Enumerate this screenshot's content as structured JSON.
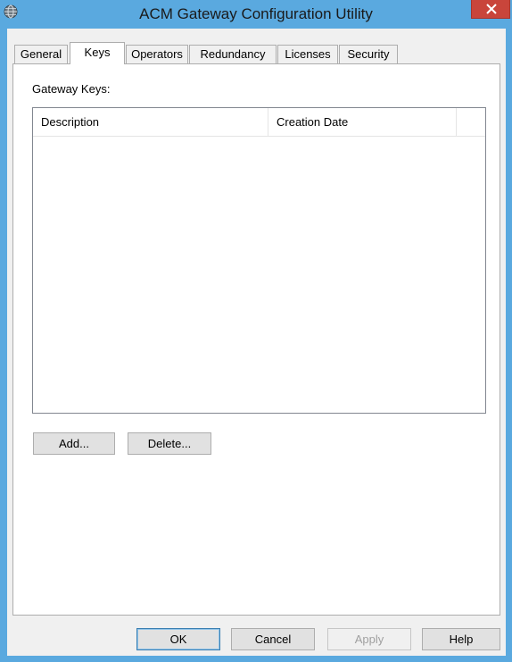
{
  "window": {
    "title": "ACM Gateway Configuration Utility"
  },
  "tabs": [
    {
      "label": "General",
      "active": false
    },
    {
      "label": "Keys",
      "active": true
    },
    {
      "label": "Operators",
      "active": false
    },
    {
      "label": "Redundancy",
      "active": false
    },
    {
      "label": "Licenses",
      "active": false
    },
    {
      "label": "Security",
      "active": false
    }
  ],
  "keys_panel": {
    "group_label": "Gateway Keys:",
    "columns": [
      "Description",
      "Creation Date"
    ],
    "rows": [],
    "add_label": "Add...",
    "delete_label": "Delete..."
  },
  "footer": {
    "ok_label": "OK",
    "cancel_label": "Cancel",
    "apply_label": "Apply",
    "apply_enabled": false,
    "help_label": "Help"
  },
  "icons": {
    "app": "globe-icon",
    "close": "close-icon"
  },
  "colors": {
    "titlebar": "#5aa9df",
    "close_button": "#c9453b",
    "dialog_background": "#f0f0f0"
  }
}
